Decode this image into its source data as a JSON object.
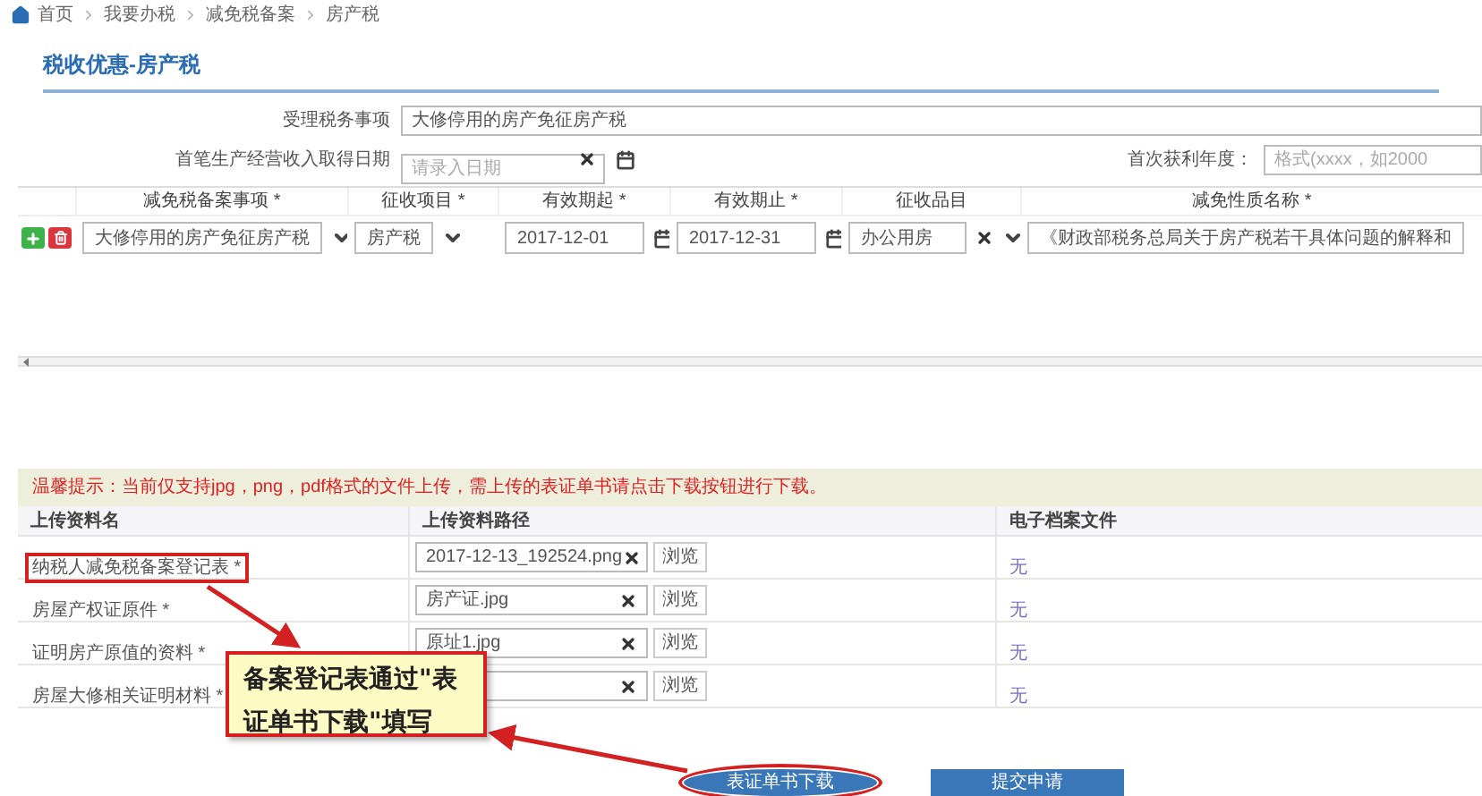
{
  "breadcrumb": [
    {
      "label": "首页"
    },
    {
      "label": "我要办税"
    },
    {
      "label": "减免税备案"
    },
    {
      "label": "房产税"
    }
  ],
  "title": "税收优惠-房产税",
  "form": {
    "tax_matter": {
      "label": "受理税务事项",
      "value": "大修停用的房产免征房产税"
    },
    "first_income_date": {
      "label": "首笔生产经营收入取得日期",
      "placeholder": "请录入日期"
    },
    "first_profit_year": {
      "label": "首次获利年度：",
      "placeholder": "格式(xxxx，如2000"
    }
  },
  "filing_table": {
    "columns": [
      "减免税备案事项 *",
      "征收项目 *",
      "有效期起 *",
      "有效期止 *",
      "征收品目",
      "减免性质名称 *"
    ],
    "rows": [
      {
        "cells": [
          {
            "kind": "select",
            "value": "大修停用的房产免征房产税"
          },
          {
            "kind": "select",
            "value": "房产税"
          },
          {
            "kind": "date",
            "value": "2017-12-01"
          },
          {
            "kind": "date",
            "value": "2017-12-31"
          },
          {
            "kind": "clearable-select",
            "value": "办公用房"
          },
          {
            "kind": "text",
            "value": "《财政部税务总局关于房产税若干具体问题的解释和"
          }
        ]
      }
    ]
  },
  "hint": "温馨提示：当前仅支持jpg，png，pdf格式的文件上传，需上传的表证单书请点击下载按钮进行下载。",
  "upload_table": {
    "columns": [
      "上传资料名",
      "上传资料路径",
      "电子档案文件"
    ],
    "rows": [
      {
        "name": "纳税人减免税备案登记表 *",
        "path": "2017-12-13_192524.png",
        "browse": "浏览",
        "archive": "无",
        "highlighted": true
      },
      {
        "name": "房屋产权证原件 *",
        "path": "房产证.jpg",
        "browse": "浏览",
        "archive": "无",
        "highlighted": false
      },
      {
        "name": "证明房产原值的资料 *",
        "path": "原址1.jpg",
        "browse": "浏览",
        "archive": "无",
        "highlighted": false
      },
      {
        "name": "房屋大修相关证明材料 *",
        "browse": "浏览",
        "archive": "无",
        "highlighted": false
      }
    ]
  },
  "callout": {
    "text": "备案登记表通过\"表证单书下载\"填写"
  },
  "buttons": [
    {
      "label": "表证单书下载",
      "highlighted": true
    },
    {
      "label": "提交申请",
      "highlighted": false
    }
  ]
}
